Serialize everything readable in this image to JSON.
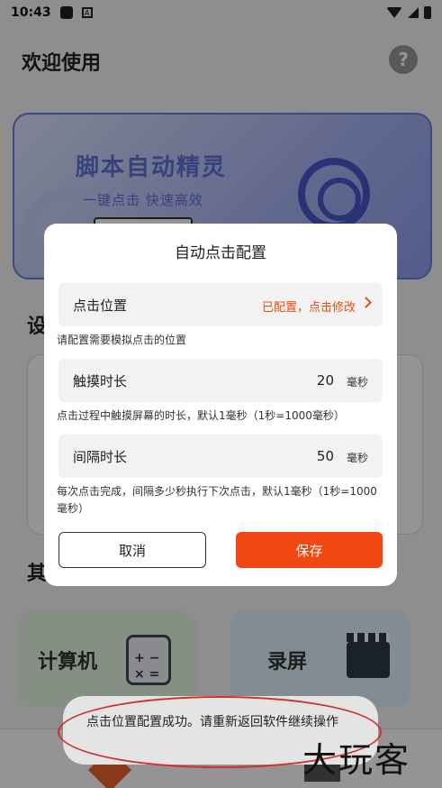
{
  "status_bar": {
    "time": "10:43",
    "notif_badge": "A"
  },
  "app": {
    "title": "欢迎使用",
    "help_icon": "?"
  },
  "banner": {
    "title": "脚本自动精灵",
    "subtitle": "一键点击  快速高效"
  },
  "sections": {
    "settings_heading": "设",
    "other_heading": "其"
  },
  "tools": [
    {
      "label": "计算机",
      "icon": "calculator-icon"
    },
    {
      "label": "录屏",
      "icon": "clapperboard-icon"
    }
  ],
  "dialog": {
    "title": "自动点击配置",
    "position": {
      "label": "点击位置",
      "value": "已配置，点击修改"
    },
    "position_hint": "请配置需要模拟点击的位置",
    "touch_duration": {
      "label": "触摸时长",
      "value": "20",
      "unit": "毫秒"
    },
    "touch_hint": "点击过程中触摸屏幕的时长，默认1毫秒（1秒=1000毫秒）",
    "interval": {
      "label": "间隔时长",
      "value": "50",
      "unit": "毫秒"
    },
    "interval_hint": "每次点击完成，间隔多少秒执行下次点击，默认1毫秒（1秒=1000毫秒）",
    "cancel_label": "取消",
    "save_label": "保存"
  },
  "toast": {
    "message": "点击位置配置成功。请重新返回软件继续操作"
  },
  "watermark": "大玩客",
  "colors": {
    "accent": "#f04810",
    "link": "#ea4c0f",
    "scrim": "rgba(0,0,0,0.42)"
  }
}
